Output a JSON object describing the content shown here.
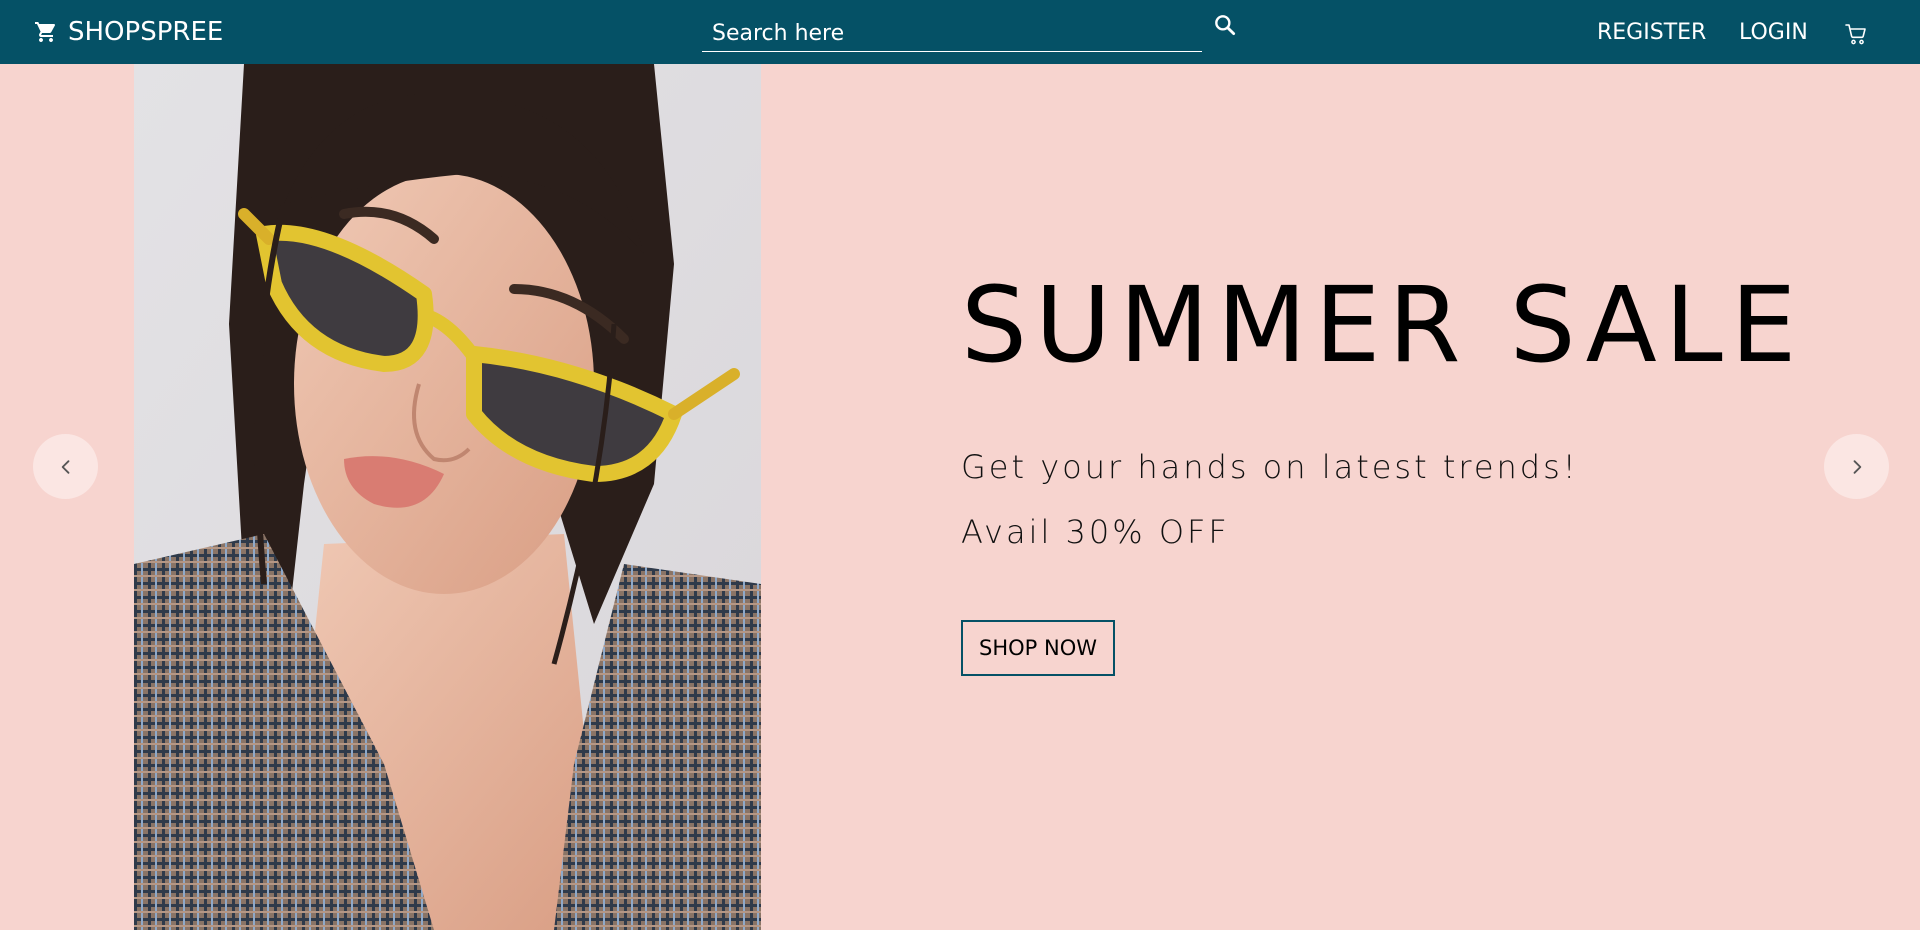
{
  "navbar": {
    "brand_name": "SHOPSPREE",
    "brand_icon": "shopping-cart-icon",
    "search_placeholder": "Search here",
    "search_value": "",
    "search_icon": "search-icon",
    "register_label": "REGISTER",
    "login_label": "LOGIN",
    "cart_icon": "cart-icon",
    "background_color": "#055166"
  },
  "hero": {
    "title": "SUMMER SALE",
    "subtitle": "Get your hands on latest trends!",
    "offer": "Avail 30% OFF",
    "cta_label": "SHOP NOW",
    "background_color": "#f7d4cf",
    "prev_icon": "chevron-left-icon",
    "next_icon": "chevron-right-icon"
  }
}
